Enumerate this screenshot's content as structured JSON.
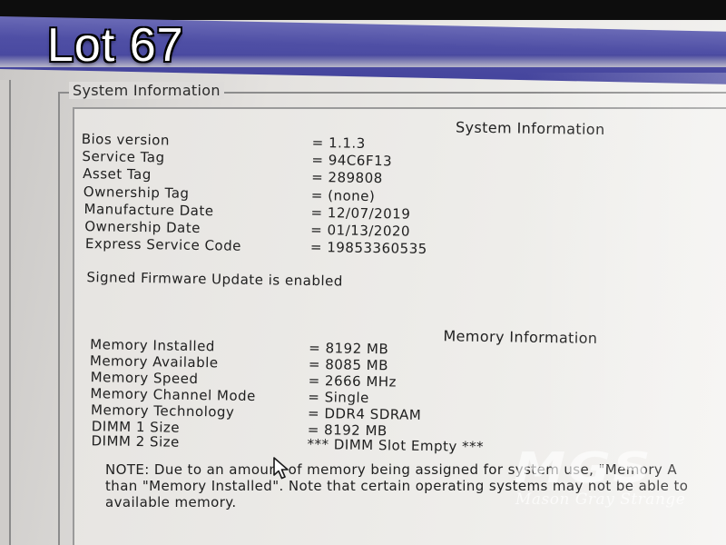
{
  "overlay": {
    "lot_label": "Lot 67"
  },
  "group": {
    "title": "System Information"
  },
  "system_info": {
    "heading": "System Information",
    "rows": [
      {
        "label": "Bios version",
        "value": "= 1.1.3"
      },
      {
        "label": "Service Tag",
        "value": "= 94C6F13"
      },
      {
        "label": "Asset Tag",
        "value": "= 289808"
      },
      {
        "label": "Ownership Tag",
        "value": "= (none)"
      },
      {
        "label": "Manufacture Date",
        "value": "= 12/07/2019"
      },
      {
        "label": "Ownership Date",
        "value": "= 01/13/2020"
      },
      {
        "label": "Express Service Code",
        "value": "= 19853360535"
      }
    ],
    "firmware_status": "Signed Firmware Update is enabled"
  },
  "memory_info": {
    "heading": "Memory Information",
    "rows": [
      {
        "label": "Memory Installed",
        "value": "= 8192 MB"
      },
      {
        "label": "Memory Available",
        "value": "= 8085 MB"
      },
      {
        "label": "Memory Speed",
        "value": "= 2666 MHz"
      },
      {
        "label": "Memory Channel Mode",
        "value": "= Single"
      },
      {
        "label": "Memory Technology",
        "value": "= DDR4 SDRAM"
      },
      {
        "label": "DIMM 1 Size",
        "value": "= 8192 MB"
      },
      {
        "label": "DIMM 2 Size",
        "value": "*** DIMM Slot Empty ***"
      }
    ],
    "note_lines": [
      "NOTE: Due to an amount of memory being assigned for system use, \"Memory A",
      "than \"Memory Installed\". Note that certain operating systems may not be able to",
      "available memory."
    ]
  },
  "watermark": {
    "logo": "MGS",
    "text": "Mason Gray Strange"
  },
  "icons": {
    "cursor": "mouse-pointer-icon"
  }
}
